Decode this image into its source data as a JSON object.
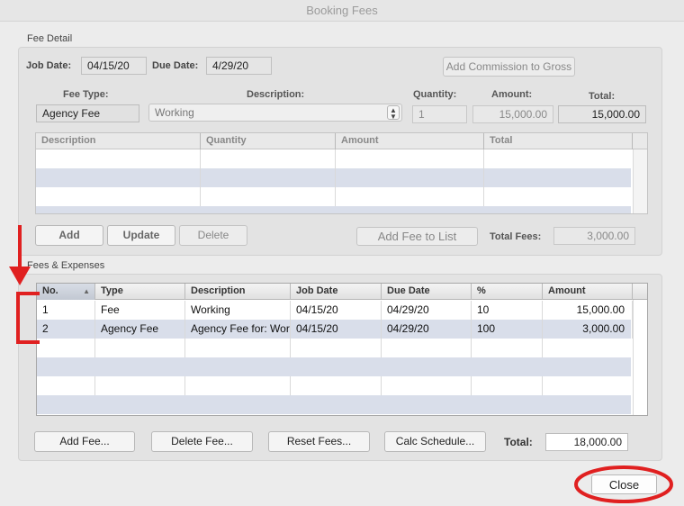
{
  "window": {
    "title": "Booking Fees"
  },
  "fee_detail": {
    "section_label": "Fee Detail",
    "job_date_label": "Job Date:",
    "job_date": "04/15/20",
    "due_date_label": "Due Date:",
    "due_date": "4/29/20",
    "add_commission_label": "Add Commission to Gross",
    "fee_type_label": "Fee Type:",
    "fee_type": "Agency Fee",
    "description_label": "Description:",
    "description": "Working",
    "quantity_label": "Quantity:",
    "quantity": "1",
    "amount_label": "Amount:",
    "amount": "15,000.00",
    "total_label": "Total:",
    "total": "15,000.00",
    "table": {
      "columns": [
        "Description",
        "Quantity",
        "Amount",
        "Total"
      ],
      "rows": []
    },
    "buttons": {
      "add": "Add",
      "update": "Update",
      "delete": "Delete",
      "add_to_list": "Add Fee to List"
    },
    "total_fees_label": "Total Fees:",
    "total_fees": "3,000.00"
  },
  "fees_expenses": {
    "section_label": "Fees & Expenses",
    "table": {
      "columns": [
        "No.",
        "Type",
        "Description",
        "Job Date",
        "Due Date",
        "%",
        "Amount"
      ],
      "rows": [
        {
          "no": "1",
          "type": "Fee",
          "description": "Working",
          "job_date": "04/15/20",
          "due_date": "04/29/20",
          "pct": "10",
          "amount": "15,000.00"
        },
        {
          "no": "2",
          "type": "Agency Fee",
          "description": "Agency Fee for: Worl",
          "job_date": "04/15/20",
          "due_date": "04/29/20",
          "pct": "100",
          "amount": "3,000.00"
        }
      ]
    },
    "buttons": {
      "add_fee": "Add Fee...",
      "delete_fee": "Delete Fee...",
      "reset_fees": "Reset Fees...",
      "calc_schedule": "Calc Schedule..."
    },
    "total_label": "Total:",
    "total": "18,000.00"
  },
  "close_label": "Close",
  "icons": {
    "sort": "sort-ascending-icon",
    "stepper": "updown-stepper-icon"
  },
  "colors": {
    "annotation": "#e02020",
    "row_alt": "#d9deea"
  }
}
